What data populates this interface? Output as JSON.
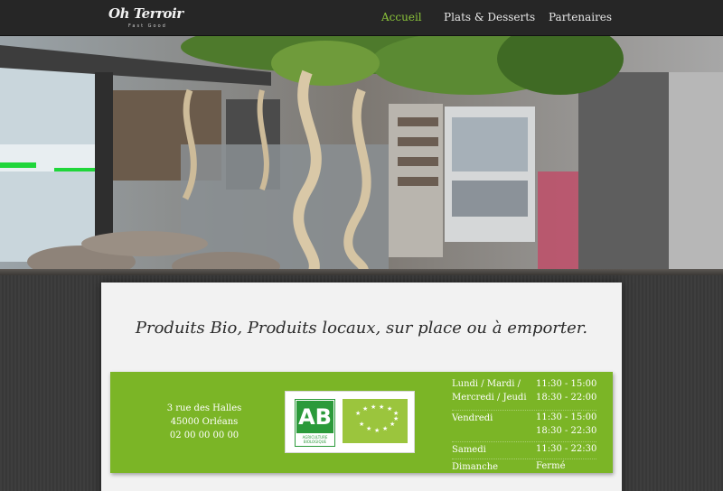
{
  "header": {
    "logo_text": "Oh Terroir",
    "logo_subtitle": "Fast Good",
    "nav": [
      {
        "label": "Accueil",
        "active": true
      },
      {
        "label": "Plats & Desserts",
        "active": false
      },
      {
        "label": "Partenaires",
        "active": false
      }
    ]
  },
  "hero": {
    "image_alt": "Intérieur du restaurant Oh Terroir"
  },
  "main": {
    "tagline": "Produits Bio, Produits locaux, sur place ou à emporter.",
    "address": {
      "street": "3 rue des Halles",
      "city": "45000 Orléans",
      "phone": "02 00 00 00 00"
    },
    "labels": {
      "ab_letters": "AB",
      "ab_text_1": "AGRICULTURE",
      "ab_text_2": "BIOLOGIQUE"
    },
    "hours": [
      {
        "day": "Lundi / Mardi /",
        "day2": "Mercredi / Jeudi",
        "times": [
          "11:30 - 15:00",
          "18:30 - 22:00"
        ]
      },
      {
        "day": "Vendredi",
        "times": [
          "11:30 - 15:00",
          "18:30 - 22:30"
        ]
      },
      {
        "day": "Samedi",
        "times": [
          "11:30 - 22:30"
        ]
      },
      {
        "day": "Dimanche",
        "times": [
          "Fermé"
        ]
      }
    ]
  },
  "colors": {
    "accent_green": "#8bc43a",
    "box_green": "#7bb526",
    "header_bg": "#262626",
    "ab_green": "#2b9a3a"
  }
}
